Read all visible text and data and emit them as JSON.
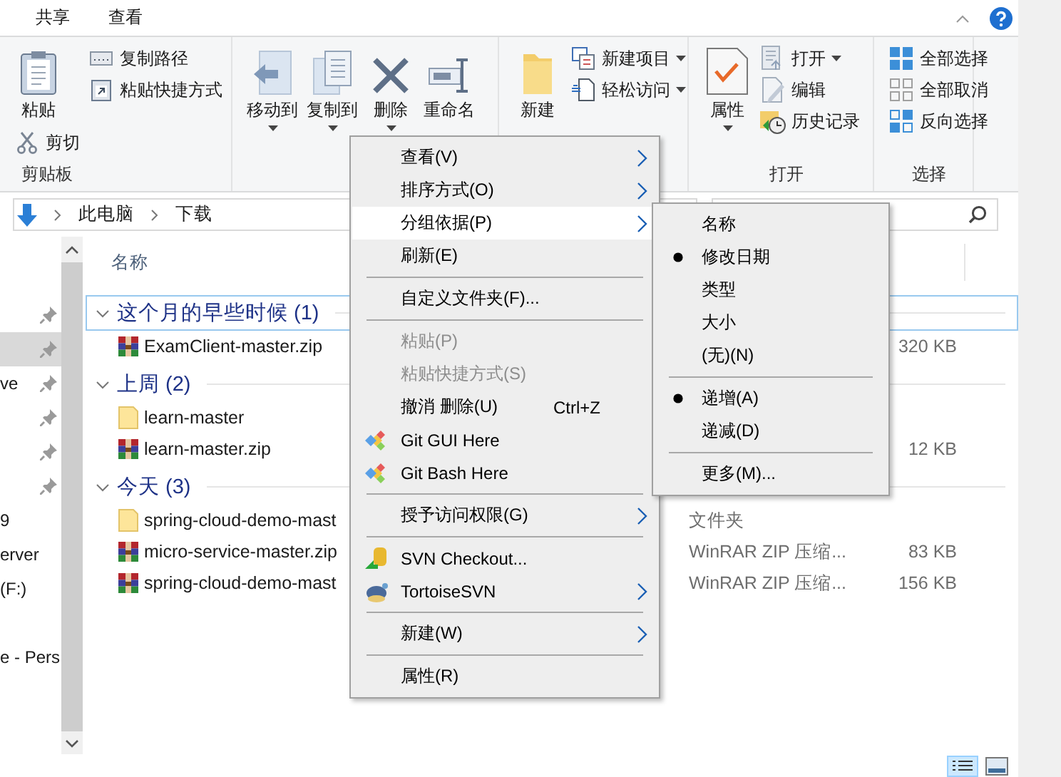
{
  "ribbon": {
    "tabs": [
      {
        "label": "共享",
        "selected": false
      },
      {
        "label": "查看",
        "selected": false
      }
    ],
    "groups": [
      {
        "label": "剪贴板",
        "columns": [
          [
            {
              "label": "粘贴",
              "kind": "large"
            },
            {
              "label": "剪切",
              "kind": "small"
            }
          ],
          [
            {
              "label": "复制路径",
              "kind": "small"
            },
            {
              "label": "粘贴快捷方式",
              "kind": "small"
            }
          ]
        ]
      },
      {
        "columns": [
          [
            {
              "label": "移动到",
              "kind": "large",
              "dropdown": true
            }
          ],
          [
            {
              "label": "复制到",
              "kind": "large",
              "dropdown": true
            }
          ],
          [
            {
              "label": "删除",
              "kind": "large",
              "dropdown": true
            }
          ],
          [
            {
              "label": "重命名",
              "kind": "large"
            }
          ]
        ]
      },
      {
        "columns": [
          [
            {
              "label": "新建",
              "kind": "large"
            }
          ],
          [
            {
              "label": "新建项目",
              "kind": "small",
              "dropdown": true
            },
            {
              "label": "轻松访问",
              "kind": "small",
              "dropdown": true
            }
          ]
        ]
      },
      {
        "label": "打开",
        "columns": [
          [
            {
              "label": "属性",
              "kind": "large",
              "dropdown": true
            }
          ],
          [
            {
              "label": "打开",
              "kind": "small",
              "dropdown": true
            },
            {
              "label": "编辑",
              "kind": "small"
            },
            {
              "label": "历史记录",
              "kind": "small"
            }
          ]
        ]
      },
      {
        "label": "选择",
        "columns": [
          [
            {
              "label": "全部选择",
              "kind": "small"
            },
            {
              "label": "全部取消",
              "kind": "small"
            },
            {
              "label": "反向选择",
              "kind": "small"
            }
          ]
        ]
      }
    ]
  },
  "address": {
    "path": [
      "此电脑",
      "下载"
    ]
  },
  "nav_pane": {
    "items": [
      {
        "pinned": true,
        "selected": false
      },
      {
        "pinned": true,
        "selected": true
      },
      {
        "text": "ve",
        "pinned": true,
        "selected": false
      },
      {
        "pinned": true,
        "selected": false
      },
      {
        "pinned": true,
        "selected": false
      },
      {
        "pinned": true,
        "selected": false
      },
      {
        "text": "9",
        "pinned": false,
        "selected": false
      },
      {
        "text": "erver",
        "pinned": false,
        "selected": false
      },
      {
        "text": "(F:)",
        "pinned": false,
        "selected": false
      },
      {
        "pinned": false,
        "selected": false
      },
      {
        "text": "e - Pers",
        "pinned": false,
        "selected": false
      }
    ]
  },
  "file_list": {
    "columns": [
      "名称"
    ],
    "groups": [
      {
        "title": "这个月的早些时候 (1)",
        "expanded": true,
        "focused": true,
        "files": [
          {
            "name": "ExamClient-master.zip",
            "kind": "zip",
            "size": "320 KB"
          }
        ]
      },
      {
        "title": "上周 (2)",
        "expanded": true,
        "focused": false,
        "files": [
          {
            "name": "learn-master",
            "kind": "folder"
          },
          {
            "name": "learn-master.zip",
            "kind": "zip",
            "size": "12 KB"
          }
        ]
      },
      {
        "title": "今天 (3)",
        "expanded": true,
        "focused": false,
        "files": [
          {
            "name": "spring-cloud-demo-mast",
            "kind": "folder",
            "type": "文件夹"
          },
          {
            "name": "micro-service-master.zip",
            "kind": "zip",
            "type": "WinRAR ZIP 压缩...",
            "size": "83 KB"
          },
          {
            "name": "spring-cloud-demo-mast",
            "kind": "zip",
            "type": "WinRAR ZIP 压缩...",
            "size": "156 KB"
          }
        ]
      }
    ]
  },
  "context_menu": {
    "items": [
      {
        "kind": "plain",
        "label": "查看(V)",
        "submenu": true,
        "selected": false,
        "disabled": false
      },
      {
        "kind": "plain",
        "label": "排序方式(O)",
        "submenu": true,
        "selected": false,
        "disabled": false
      },
      {
        "kind": "plain",
        "label": "分组依据(P)",
        "submenu": true,
        "selected": true,
        "disabled": false
      },
      {
        "kind": "plain",
        "label": "刷新(E)",
        "submenu": false,
        "selected": false,
        "disabled": false
      },
      {
        "kind": "separator"
      },
      {
        "kind": "plain",
        "label": "自定义文件夹(F)...",
        "submenu": false,
        "selected": false,
        "disabled": false
      },
      {
        "kind": "separator"
      },
      {
        "kind": "plain",
        "label": "粘贴(P)",
        "submenu": false,
        "selected": false,
        "disabled": true
      },
      {
        "kind": "plain",
        "label": "粘贴快捷方式(S)",
        "submenu": false,
        "selected": false,
        "disabled": true
      },
      {
        "kind": "plain",
        "label": "撤消 删除(U)",
        "shortcut": "Ctrl+Z",
        "submenu": false,
        "selected": false,
        "disabled": false
      },
      {
        "kind": "git",
        "label": "Git GUI Here",
        "submenu": false,
        "selected": false,
        "disabled": false
      },
      {
        "kind": "git",
        "label": "Git Bash Here",
        "submenu": false,
        "selected": false,
        "disabled": false
      },
      {
        "kind": "separator"
      },
      {
        "kind": "plain",
        "label": "授予访问权限(G)",
        "submenu": true,
        "selected": false,
        "disabled": false
      },
      {
        "kind": "separator"
      },
      {
        "kind": "checkout",
        "label": "SVN Checkout...",
        "submenu": false,
        "selected": false,
        "disabled": false
      },
      {
        "kind": "tortoise",
        "label": "TortoiseSVN",
        "submenu": true,
        "selected": false,
        "disabled": false
      },
      {
        "kind": "separator"
      },
      {
        "kind": "plain",
        "label": "新建(W)",
        "submenu": true,
        "selected": false,
        "disabled": false
      },
      {
        "kind": "separator"
      },
      {
        "kind": "plain",
        "label": "属性(R)",
        "submenu": false,
        "selected": false,
        "disabled": false
      }
    ]
  },
  "submenu": {
    "items": [
      {
        "kind": "item",
        "label": "名称",
        "checked": false
      },
      {
        "kind": "item",
        "label": "修改日期",
        "checked": true
      },
      {
        "kind": "item",
        "label": "类型",
        "checked": false
      },
      {
        "kind": "item",
        "label": "大小",
        "checked": false
      },
      {
        "kind": "item",
        "label": "(无)(N)",
        "checked": false
      },
      {
        "kind": "separator"
      },
      {
        "kind": "item",
        "label": "递增(A)",
        "checked": true
      },
      {
        "kind": "item",
        "label": "递减(D)",
        "checked": false
      },
      {
        "kind": "separator"
      },
      {
        "kind": "item",
        "label": "更多(M)...",
        "checked": false
      }
    ]
  }
}
